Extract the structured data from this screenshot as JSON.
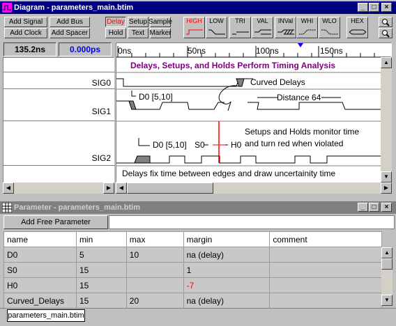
{
  "diagram_window": {
    "title": "Diagram - parameters_main.btim",
    "toolbar": {
      "add_signal": "Add Signal",
      "add_bus": "Add Bus",
      "add_clock": "Add Clock",
      "add_spacer": "Add Spacer",
      "delay": "Delay",
      "setup": "Setup",
      "sample": "Sample",
      "hold": "Hold",
      "text": "Text",
      "marker": "Marker",
      "wave_buttons": [
        "HIGH",
        "LOW",
        "TRI",
        "VAL",
        "INVal",
        "WHI",
        "WLO",
        "HEX"
      ]
    },
    "time_display": "135.2ns",
    "delta_display": "0.000ps",
    "ruler_ticks": [
      "0ns",
      "50ns",
      "100ns",
      "150ns"
    ],
    "signals": [
      "SIG0",
      "SIG1",
      "SIG2"
    ],
    "annotations": {
      "heading": "Delays, Setups, and Holds Perform Timing Analysis",
      "curved_delays": "Curved  Delays",
      "d0_top": "D0 [5,10]",
      "distance": "Distance 64",
      "d0_bottom": "D0 [5,10]",
      "s0": "S0",
      "h0": "H0",
      "setup_note_1": "Setups and Holds monitor time",
      "setup_note_2": "and turn red when violated",
      "footer_note": "Delays fix time between edges and draw uncertainity time"
    },
    "colors": {
      "heading": "#800080",
      "violation": "#ff0000",
      "active_button": "#ff0000"
    }
  },
  "parameter_window": {
    "title": "Parameter - parameters_main.btim",
    "add_free_parameter": "Add Free Parameter",
    "columns": [
      "name",
      "min",
      "max",
      "margin",
      "comment"
    ],
    "rows": [
      {
        "name": "D0",
        "min": "5",
        "max": "10",
        "margin": "na (delay)",
        "comment": "",
        "violated": false
      },
      {
        "name": "S0",
        "min": "15",
        "max": "",
        "margin": "1",
        "comment": "",
        "violated": false
      },
      {
        "name": "H0",
        "min": "15",
        "max": "",
        "margin": "-7",
        "comment": "",
        "violated": true
      },
      {
        "name": "Curved_Delays",
        "min": "15",
        "max": "20",
        "margin": "na (delay)",
        "comment": "",
        "violated": false
      }
    ],
    "tab": "parameters_main.btim"
  }
}
